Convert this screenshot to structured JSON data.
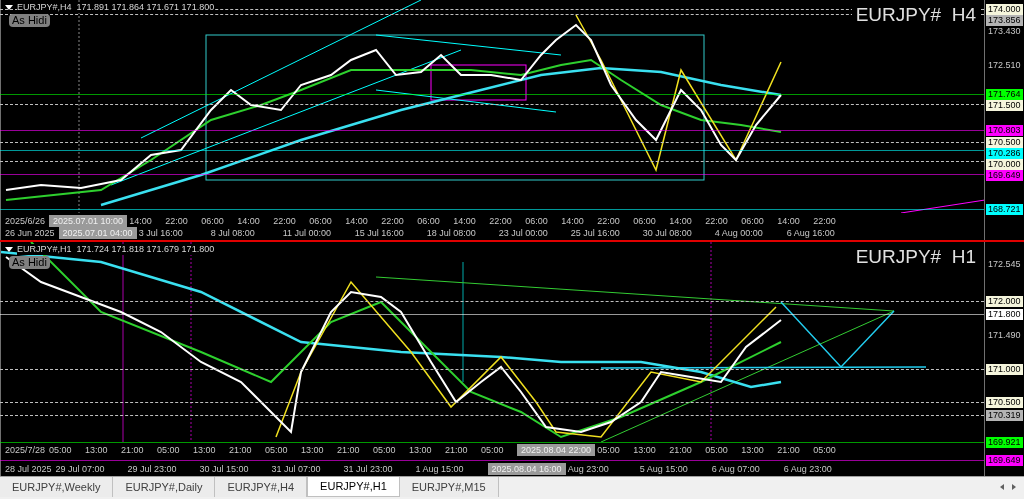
{
  "panels": [
    {
      "header": "EURJPY#,H4  171.891 171.864 171.671 171.800",
      "hide_button": "As Hidi",
      "symbol": "EURJPY#  H4",
      "price_labels": [
        {
          "price": "174.000",
          "kind": "badge",
          "color": "#f5f5dc",
          "dashed": true
        },
        {
          "price": "173.856",
          "kind": "badge",
          "color": "#b4b4b4",
          "dashed": true
        },
        {
          "price": "173.430",
          "kind": "plain"
        },
        {
          "price": "172.510",
          "kind": "plain"
        },
        {
          "price": "171.764",
          "kind": "badge",
          "color": "#00ff00",
          "dashed": false
        },
        {
          "price": "171.500",
          "kind": "badge",
          "color": "#f5f5dc",
          "dashed": true
        },
        {
          "price": "170.803",
          "kind": "badge",
          "color": "#ff00ff",
          "dashed": false
        },
        {
          "price": "170.500",
          "kind": "badge",
          "color": "#f5f5dc",
          "dashed": true
        },
        {
          "price": "170.286",
          "kind": "badge",
          "color": "#00ffff",
          "dashed": false
        },
        {
          "price": "170.000",
          "kind": "badge",
          "color": "#f5f5dc",
          "dashed": true
        },
        {
          "price": "169.649",
          "kind": "badge",
          "color": "#ff00ff",
          "dashed": false
        },
        {
          "price": "168.721",
          "kind": "badge",
          "color": "#00ffff",
          "dashed": false
        }
      ],
      "time_rows": [
        [
          {
            "text": "2025/6/26",
            "kind": "start"
          },
          {
            "text": "2025.07.01 10:00",
            "kind": "cursor"
          },
          {
            "text": "14:00",
            "kind": "tick"
          },
          {
            "text": "22:00",
            "kind": "tick"
          },
          {
            "text": "06:00",
            "kind": "tick"
          },
          {
            "text": "14:00",
            "kind": "tick"
          },
          {
            "text": "22:00",
            "kind": "tick"
          },
          {
            "text": "06:00",
            "kind": "tick"
          },
          {
            "text": "14:00",
            "kind": "tick"
          },
          {
            "text": "22:00",
            "kind": "tick"
          },
          {
            "text": "06:00",
            "kind": "tick"
          },
          {
            "text": "14:00",
            "kind": "tick"
          },
          {
            "text": "22:00",
            "kind": "tick"
          },
          {
            "text": "06:00",
            "kind": "tick"
          },
          {
            "text": "14:00",
            "kind": "tick"
          },
          {
            "text": "22:00",
            "kind": "tick"
          },
          {
            "text": "06:00",
            "kind": "tick"
          },
          {
            "text": "14:00",
            "kind": "tick"
          },
          {
            "text": "22:00",
            "kind": "tick"
          },
          {
            "text": "06:00",
            "kind": "tick"
          },
          {
            "text": "14:00",
            "kind": "tick"
          },
          {
            "text": "22:00",
            "kind": "tick"
          }
        ],
        [
          {
            "text": "26 Jun 2025",
            "kind": "start"
          },
          {
            "text": "2025.07.01 04:00",
            "kind": "cursor"
          },
          {
            "text": "3 Jul 16:00",
            "kind": "date"
          },
          {
            "text": "8 Jul 08:00",
            "kind": "date"
          },
          {
            "text": "11 Jul 00:00",
            "kind": "date"
          },
          {
            "text": "15 Jul 16:00",
            "kind": "date"
          },
          {
            "text": "18 Jul 08:00",
            "kind": "date"
          },
          {
            "text": "23 Jul 00:00",
            "kind": "date"
          },
          {
            "text": "25 Jul 16:00",
            "kind": "date"
          },
          {
            "text": "30 Jul 08:00",
            "kind": "date"
          },
          {
            "text": "4 Aug 00:00",
            "kind": "date"
          },
          {
            "text": "6 Aug 16:00",
            "kind": "date"
          }
        ]
      ]
    },
    {
      "header": "EURJPY#,H1  171.724 171.818 171.679 171.800",
      "hide_button": "As Hidi",
      "symbol": "EURJPY#  H1",
      "price_labels": [
        {
          "price": "172.545",
          "kind": "plain"
        },
        {
          "price": "172.000",
          "kind": "badge",
          "color": "#f5f5dc",
          "dashed": true
        },
        {
          "price": "171.800",
          "kind": "badge",
          "color": "#ffffff",
          "dashed": false
        },
        {
          "price": "171.490",
          "kind": "plain"
        },
        {
          "price": "171.000",
          "kind": "badge",
          "color": "#f5f5dc",
          "dashed": true
        },
        {
          "price": "170.500",
          "kind": "badge",
          "color": "#f5f5dc",
          "dashed": true
        },
        {
          "price": "170.319",
          "kind": "badge",
          "color": "#b4b4b4",
          "dashed": true
        },
        {
          "price": "169.921",
          "kind": "badge",
          "color": "#00ff00",
          "dashed": false
        },
        {
          "price": "169.649",
          "kind": "badge",
          "color": "#ff00ff",
          "dashed": false
        }
      ],
      "time_rows": [
        [
          {
            "text": "2025/7/28",
            "kind": "start"
          },
          {
            "text": "05:00",
            "kind": "tick"
          },
          {
            "text": "13:00",
            "kind": "tick"
          },
          {
            "text": "21:00",
            "kind": "tick"
          },
          {
            "text": "05:00",
            "kind": "tick"
          },
          {
            "text": "13:00",
            "kind": "tick"
          },
          {
            "text": "21:00",
            "kind": "tick"
          },
          {
            "text": "05:00",
            "kind": "tick"
          },
          {
            "text": "13:00",
            "kind": "tick"
          },
          {
            "text": "21:00",
            "kind": "tick"
          },
          {
            "text": "05:00",
            "kind": "tick"
          },
          {
            "text": "13:00",
            "kind": "tick"
          },
          {
            "text": "21:00",
            "kind": "tick"
          },
          {
            "text": "05:00",
            "kind": "tick"
          },
          {
            "text": "2025.08.04 22:00",
            "kind": "cursor"
          },
          {
            "text": "05:00",
            "kind": "tick"
          },
          {
            "text": "13:00",
            "kind": "tick"
          },
          {
            "text": "21:00",
            "kind": "tick"
          },
          {
            "text": "05:00",
            "kind": "tick"
          },
          {
            "text": "13:00",
            "kind": "tick"
          },
          {
            "text": "21:00",
            "kind": "tick"
          },
          {
            "text": "05:00",
            "kind": "tick"
          }
        ],
        [
          {
            "text": "28 Jul 2025",
            "kind": "start"
          },
          {
            "text": "29 Jul 07:00",
            "kind": "date"
          },
          {
            "text": "29 Jul 23:00",
            "kind": "date"
          },
          {
            "text": "30 Jul 15:00",
            "kind": "date"
          },
          {
            "text": "31 Jul 07:00",
            "kind": "date"
          },
          {
            "text": "31 Jul 23:00",
            "kind": "date"
          },
          {
            "text": "1 Aug 15:00",
            "kind": "date"
          },
          {
            "text": "2025.08.04 16:00",
            "kind": "cursor"
          },
          {
            "text": "Aug 23:00",
            "kind": "date"
          },
          {
            "text": "5 Aug 15:00",
            "kind": "date"
          },
          {
            "text": "6 Aug 07:00",
            "kind": "date"
          },
          {
            "text": "6 Aug 23:00",
            "kind": "date"
          }
        ]
      ]
    }
  ],
  "tabs": [
    {
      "label": "EURJPY#,Weekly",
      "selected": false
    },
    {
      "label": "EURJPY#,Daily",
      "selected": false
    },
    {
      "label": "EURJPY#,H4",
      "selected": false
    },
    {
      "label": "EURJPY#,H1",
      "selected": true
    },
    {
      "label": "EURJPY#,M15",
      "selected": false
    }
  ]
}
